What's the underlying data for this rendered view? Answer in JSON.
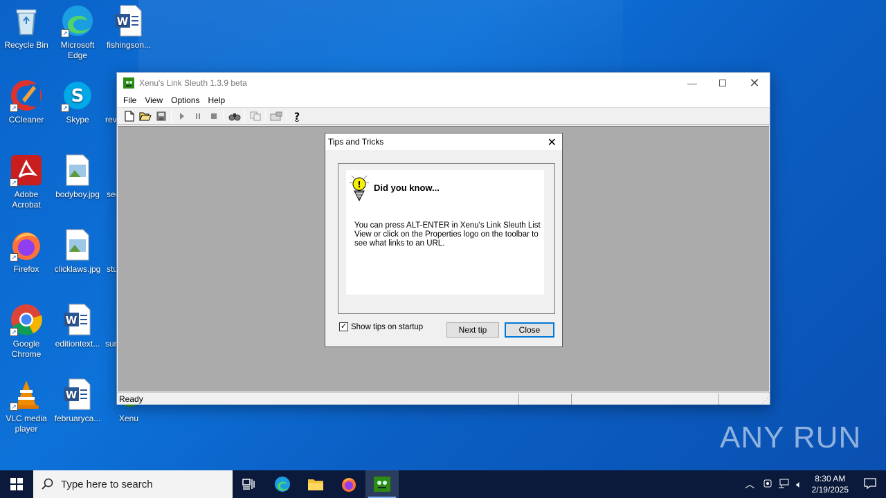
{
  "desktop": {
    "icons": [
      {
        "label": "Recycle Bin",
        "icon": "recycle-bin-icon"
      },
      {
        "label": "Microsoft Edge",
        "icon": "edge-icon"
      },
      {
        "label": "fishingson...",
        "icon": "word-doc-icon"
      },
      {
        "label": "CCleaner",
        "icon": "ccleaner-icon"
      },
      {
        "label": "Skype",
        "icon": "skype-icon"
      },
      {
        "label": "rev",
        "icon": "file-icon"
      },
      {
        "label": "Adobe Acrobat",
        "icon": "acrobat-icon"
      },
      {
        "label": "bodyboy.jpg",
        "icon": "image-file-icon"
      },
      {
        "label": "sec",
        "icon": "file-icon"
      },
      {
        "label": "Firefox",
        "icon": "firefox-icon"
      },
      {
        "label": "clicklaws.jpg",
        "icon": "image-file-icon"
      },
      {
        "label": "stu",
        "icon": "file-icon"
      },
      {
        "label": "Google Chrome",
        "icon": "chrome-icon"
      },
      {
        "label": "editiontext...",
        "icon": "word-doc-icon"
      },
      {
        "label": "sur",
        "icon": "file-icon"
      },
      {
        "label": "VLC media player",
        "icon": "vlc-icon"
      },
      {
        "label": "februaryca...",
        "icon": "word-doc-icon"
      },
      {
        "label": "Xenu",
        "icon": "xenu-icon"
      }
    ]
  },
  "window": {
    "title": "Xenu's Link Sleuth 1.3.9 beta",
    "menu": [
      "File",
      "View",
      "Options",
      "Help"
    ],
    "toolbar_icons": [
      "new-icon",
      "open-icon",
      "save-icon",
      "play-icon",
      "pause-icon",
      "stop-icon",
      "find-icon",
      "copy-icon",
      "properties-icon",
      "help-icon"
    ],
    "status": "Ready"
  },
  "dialog": {
    "title": "Tips and Tricks",
    "heading": "Did you know...",
    "tip": "You can press ALT-ENTER in Xenu's Link Sleuth List View or click on the Properties logo on the toolbar to see what links to an URL.",
    "checkbox_label": "Show tips on startup",
    "checkbox_checked": true,
    "next_button": "Next tip",
    "close_button": "Close"
  },
  "taskbar": {
    "search_placeholder": "Type here to search",
    "time": "8:30 AM",
    "date": "2/19/2025"
  },
  "watermark": {
    "text": "ANY RUN"
  },
  "colors": {
    "desktop_blue": "#0a63c9",
    "taskbar": "#0b1a3a",
    "accent": "#0078d7"
  }
}
